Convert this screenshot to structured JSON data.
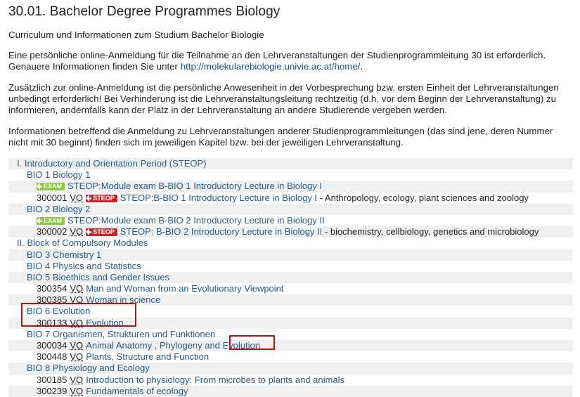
{
  "page": {
    "title": "30.01. Bachelor Degree Programmes Biology",
    "subtitle": "Curriculum und Informationen zum Studium Bachelor Biologie",
    "para1_line1": "Eine persönliche online-Anmeldung für die Teilnahme an den Lehrveranstaltungen der Studienprogrammleitung 30 ist erforderlich.",
    "para1_prefix": "Genauere Informationen finden Sie unter ",
    "para1_link": "http://molekularebiologie.univie.ac.at/home/",
    "para1_suffix": ".",
    "para2_line1": "Zusätzlich zur online-Anmeldung ist die persönliche Anwesenheit in der Vorbesprechung bzw. ersten Einheit der Lehrveranstaltungen",
    "para2_line2": "unbedingt erforderlich! Bei Verhinderung ist die Lehrveranstaltungsleitung rechtzeitig (d.h. vor dem Beginn der Lehrveranstaltung) zu",
    "para2_line3": "informieren, andernfalls kann der Platz in der Lehrveranstaltung an andere Studierende vergeben werden.",
    "para3_line1": "Informationen betreffend die Anmeldung zu Lehrveranstaltungen anderer Studienprogrammleitungen (das sind jene, deren Nummer",
    "para3_line2": "nicht mit 30 beginnt) finden sich im jeweiligen Kapitel bzw. bei der jeweiligen Lehrveranstaltung."
  },
  "tree": {
    "r1": "I. Introductory and Orientation Period (STEOP)",
    "r2": "BIO 1 Biology 1",
    "r3_tag": "EXAM",
    "r3_text": "STEOP:Module exam B-BIO 1 Introductory Lecture in Biology I",
    "r4_num": "300001",
    "r4_vo": "VO",
    "r4_tag": "STEOP",
    "r4_link": "STEOP:B-BIO 1 Introductory Lecture in Biology I",
    "r4_desc": " - Anthropology, ecology, plant sciences and zoology",
    "r5": "BIO 2 Biology 2",
    "r6_tag": "EXAM",
    "r6_text": "STEOP:Module exam B-BIO 2 Introductory Lecture in Biology II",
    "r7_num": "300002",
    "r7_vo": "VO",
    "r7_tag": "STEOP",
    "r7_link": "STEOP: B-BIO 2 Introductory Lecture in Biology II",
    "r7_desc": " - biochemistry, cellbiology, genetics and microbiology",
    "r8": "II. Block of Compulsory Modules",
    "r9": "BIO 3 Chemistry 1",
    "r10": "BIO 4 Physics and Statistics",
    "r11": "BIO 5 Bioethics and Gender Issues",
    "r12_num": "300354",
    "r12_vo": "VO",
    "r12_link": "Man and Woman from an Evolutionary Viewpoint",
    "r13_num": "300385",
    "r13_vo": "VO",
    "r13_link": "Woman in science",
    "r14": "BIO 6 Evolution",
    "r15_num": "300133",
    "r15_vo": "VO",
    "r15_link": "Evolution",
    "r16": "BIO 7 Organismen, Strukturen und Funktionen",
    "r17_num": "300034",
    "r17_vo": "VO",
    "r17_link_a": "Animal Anatomy , Phylogeny and ",
    "r17_link_b": "Evolution",
    "r18_num": "300448",
    "r18_vo": "VO",
    "r18_link": "Plants, Structure and Function",
    "r19": "BIO 8 Physiology and Ecology",
    "r20_num": "300185",
    "r20_vo": "VO",
    "r20_link": "Introduction to physiology: From microbes to plants and animals",
    "r21_num": "300239",
    "r21_vo": "VO",
    "r21_link": "Fundamentals of ecology"
  },
  "colors": {
    "link": "#1f5c8b",
    "exam_tag": "#8dc63f",
    "steop_tag": "#c0272d",
    "highlight_box": "#b3121b",
    "alt_row": "#f0f0f0"
  }
}
